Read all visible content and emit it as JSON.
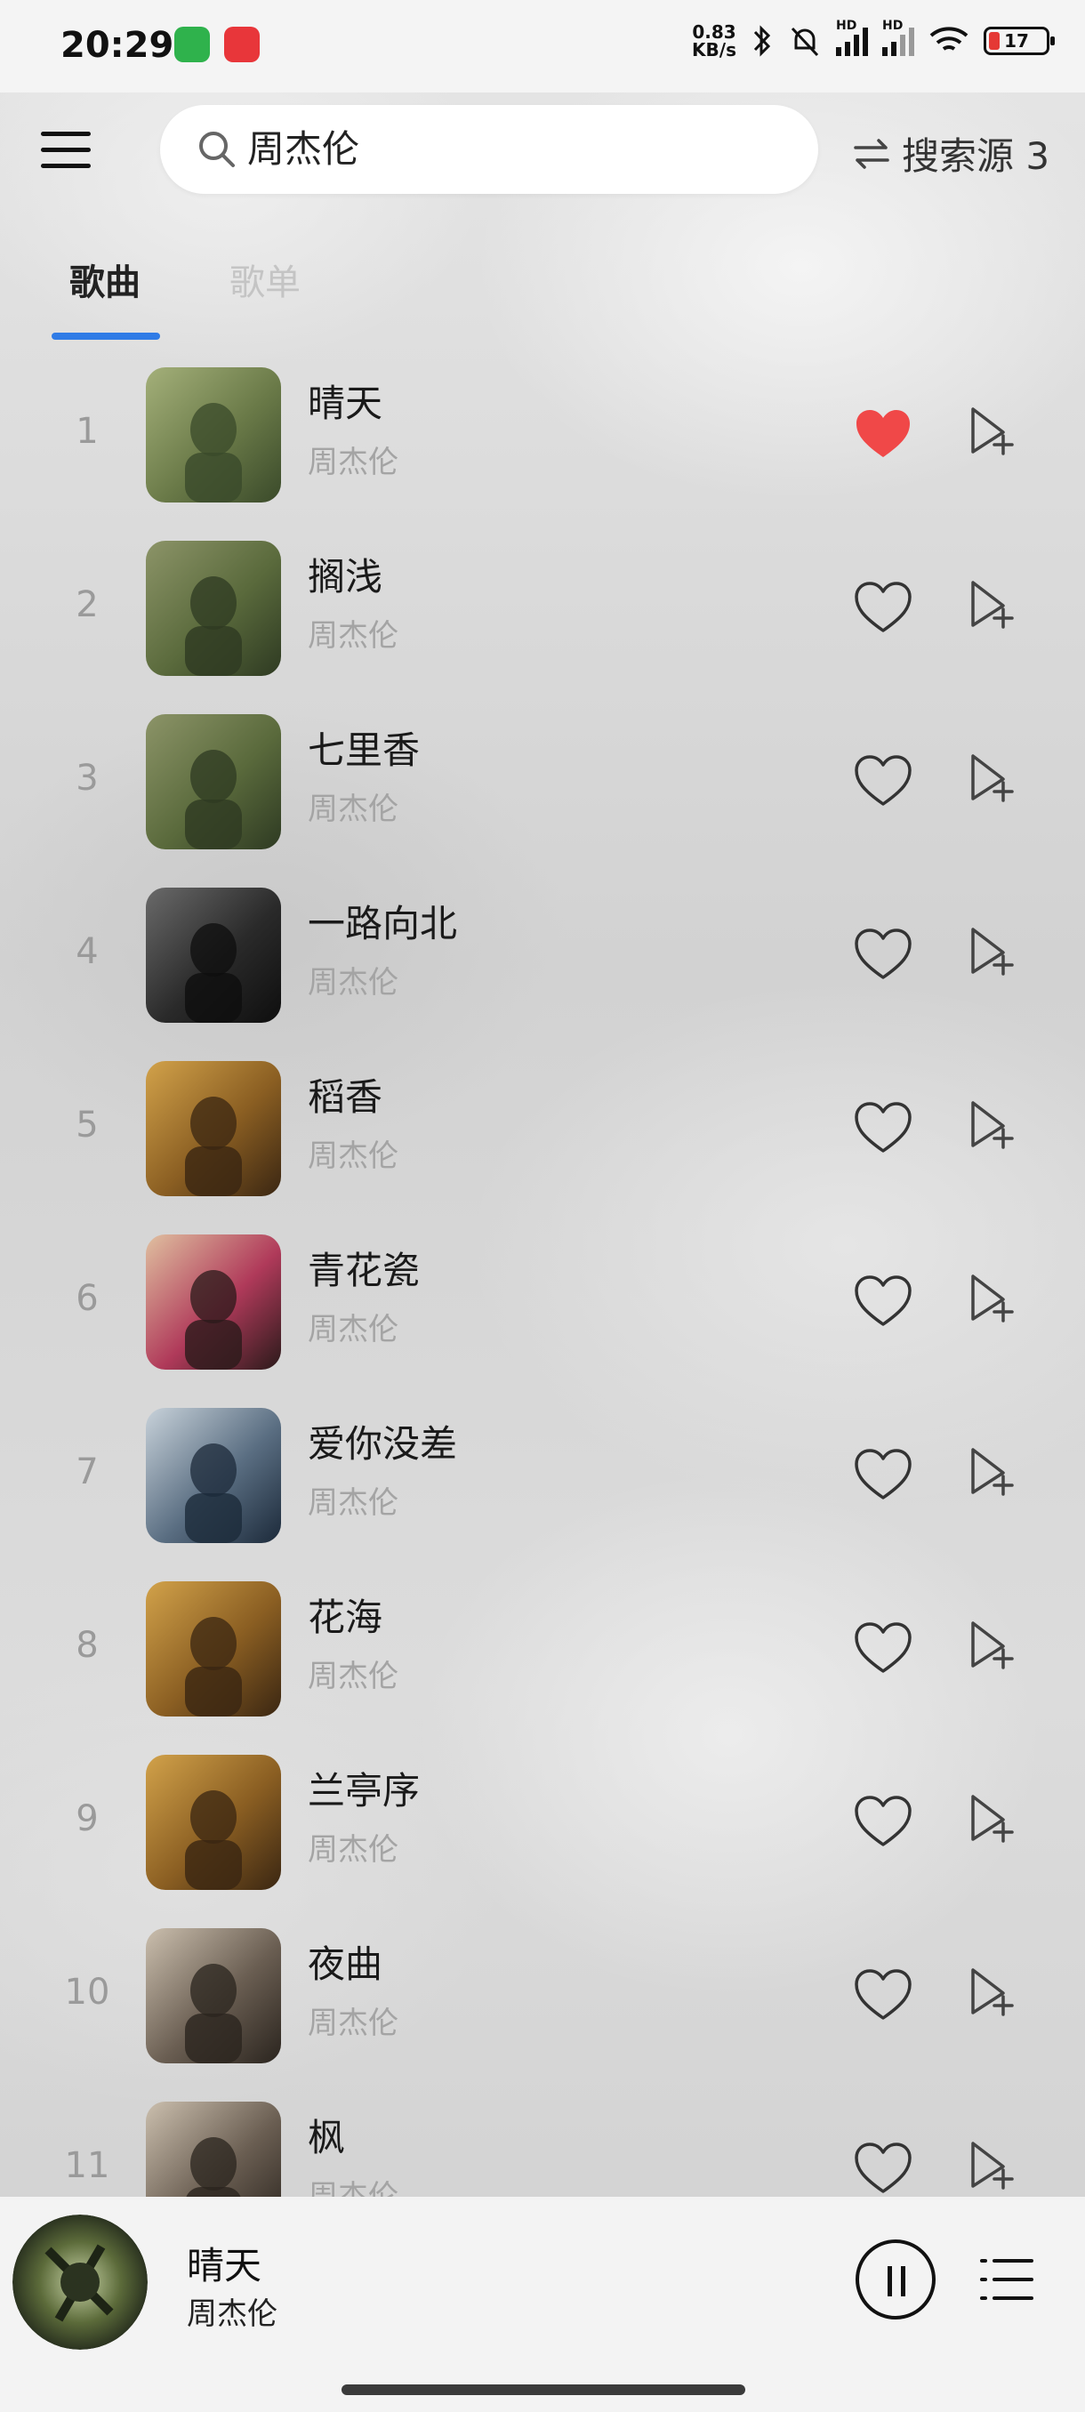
{
  "status_bar": {
    "time": "20:29",
    "net_speed_top": "0.83",
    "net_speed_bottom": "KB/s",
    "hd1": "HD",
    "hd2": "HD",
    "battery": "17"
  },
  "header": {
    "search_value": "周杰伦",
    "source_label": "搜索源 3"
  },
  "tabs": [
    {
      "label": "歌曲",
      "active": true
    },
    {
      "label": "歌单",
      "active": false
    }
  ],
  "songs": [
    {
      "index": "1",
      "title": "晴天",
      "artist": "周杰伦",
      "liked": true,
      "cover": "c1"
    },
    {
      "index": "2",
      "title": "搁浅",
      "artist": "周杰伦",
      "liked": false,
      "cover": "c2"
    },
    {
      "index": "3",
      "title": "七里香",
      "artist": "周杰伦",
      "liked": false,
      "cover": "c2"
    },
    {
      "index": "4",
      "title": "一路向北",
      "artist": "周杰伦",
      "liked": false,
      "cover": "c3"
    },
    {
      "index": "5",
      "title": "稻香",
      "artist": "周杰伦",
      "liked": false,
      "cover": "c4"
    },
    {
      "index": "6",
      "title": "青花瓷",
      "artist": "周杰伦",
      "liked": false,
      "cover": "c5"
    },
    {
      "index": "7",
      "title": "爱你没差",
      "artist": "周杰伦",
      "liked": false,
      "cover": "c6"
    },
    {
      "index": "8",
      "title": "花海",
      "artist": "周杰伦",
      "liked": false,
      "cover": "c4"
    },
    {
      "index": "9",
      "title": "兰亭序",
      "artist": "周杰伦",
      "liked": false,
      "cover": "c4"
    },
    {
      "index": "10",
      "title": "夜曲",
      "artist": "周杰伦",
      "liked": false,
      "cover": "c7"
    },
    {
      "index": "11",
      "title": "枫",
      "artist": "周杰伦",
      "liked": false,
      "cover": "c7"
    }
  ],
  "now_playing": {
    "title": "晴天",
    "artist": "周杰伦"
  },
  "colors": {
    "accent": "#2f7be6",
    "liked": "#f04848"
  },
  "icons": {
    "menu": "hamburger-icon",
    "search": "magnifier-icon",
    "source": "swap-arrows-icon",
    "like": "heart-icon",
    "add": "add-to-playlist-icon",
    "pause": "pause-icon",
    "playlist": "playlist-icon"
  }
}
